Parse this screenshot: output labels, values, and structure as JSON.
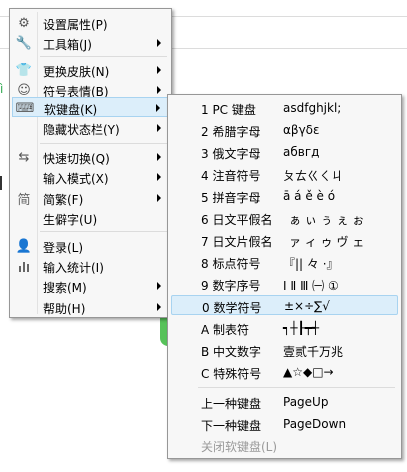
{
  "main_menu": {
    "items": [
      {
        "label": "设置属性(P)",
        "icon": "gear-icon",
        "has_submenu": false
      },
      {
        "label": "工具箱(J)",
        "icon": "wrench-icon",
        "has_submenu": true
      },
      {
        "label": "更换皮肤(N)",
        "icon": "shirt-icon",
        "has_submenu": true
      },
      {
        "label": "符号表情(B)",
        "icon": "smiley-icon",
        "has_submenu": true
      },
      {
        "label": "软键盘(K)",
        "icon": "keyboard-icon",
        "has_submenu": true,
        "selected": true
      },
      {
        "label": "隐藏状态栏(Y)",
        "icon": "",
        "has_submenu": true
      },
      {
        "label": "快速切换(Q)",
        "icon": "switch-arrows-icon",
        "has_submenu": true
      },
      {
        "label": "输入模式(X)",
        "icon": "",
        "has_submenu": true
      },
      {
        "label": "简繁(F)",
        "icon": "simplified-traditional-icon",
        "icon_text": "简",
        "has_submenu": true
      },
      {
        "label": "生僻字(U)",
        "icon": "",
        "has_submenu": false
      },
      {
        "label": "登录(L)",
        "icon": "user-icon",
        "has_submenu": false
      },
      {
        "label": "输入统计(I)",
        "icon": "bar-chart-icon",
        "has_submenu": false
      },
      {
        "label": "搜索(M)",
        "icon": "",
        "has_submenu": true
      },
      {
        "label": "帮助(H)",
        "icon": "",
        "has_submenu": true
      }
    ]
  },
  "soft_keyboard_menu": {
    "items": [
      {
        "label": "1 PC 键盘",
        "sample": "asdfghjkl;"
      },
      {
        "label": "2 希腊字母",
        "sample": "αβγδε"
      },
      {
        "label": "3 俄文字母",
        "sample": "абвгд"
      },
      {
        "label": "4 注音符号",
        "sample": "ㄆㄊㄍㄑㄐ"
      },
      {
        "label": "5 拼音字母",
        "sample": "ā á ě è ó"
      },
      {
        "label": "6 日文平假名",
        "sample": "ぁ ぃ ぅ ぇ ぉ"
      },
      {
        "label": "7 日文片假名",
        "sample": "ァ ィ ゥ ヴ ェ"
      },
      {
        "label": "8 标点符号",
        "sample": "『|| 々 ·』"
      },
      {
        "label": "9 数字序号",
        "sample": "Ⅰ Ⅱ Ⅲ ㈠ ①"
      },
      {
        "label": "0 数学符号",
        "sample": "±×÷∑√",
        "selected": true
      },
      {
        "label": "A 制表符",
        "sample": "┑┼┠┯┽"
      },
      {
        "label": "B 中文数字",
        "sample": "壹贰千万兆"
      },
      {
        "label": "C 特殊符号",
        "sample": "▲☆◆□→"
      }
    ],
    "nav_items": [
      {
        "label": "上一种键盘",
        "shortcut": "PageUp"
      },
      {
        "label": "下一种键盘",
        "shortcut": "PageDown"
      }
    ],
    "close_item": {
      "label": "关闭软键盘(L)",
      "disabled": true
    }
  },
  "colors": {
    "menu_bg": "#f7f7f7",
    "selection_bg": "#dceefa",
    "selection_border": "#a8d3f0",
    "disabled_text": "#9a9a9a"
  }
}
